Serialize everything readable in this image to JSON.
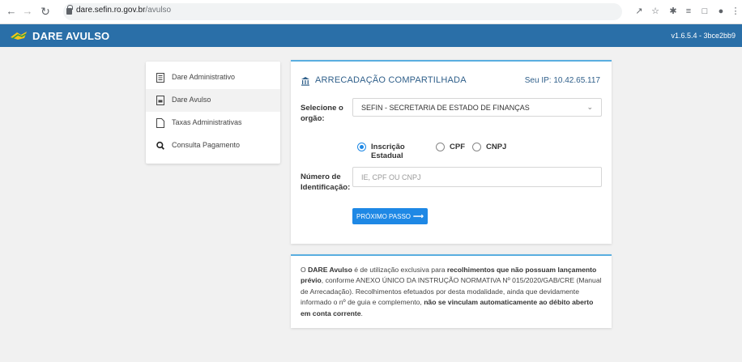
{
  "browser": {
    "url_domain": "dare.sefin.ro.gov.br",
    "url_path": "/avulso",
    "back_icon": "arrow-left-icon",
    "forward_icon": "arrow-right-icon",
    "reload_icon": "reload-icon"
  },
  "header": {
    "title": "DARE AVULSO",
    "version": "v1.6.5.4 - 3bce2bb9",
    "bg_color": "#2a6fa8"
  },
  "sidebar": {
    "items": [
      {
        "label": "Dare Administrativo",
        "icon": "document-list-icon"
      },
      {
        "label": "Dare Avulso",
        "icon": "document-icon",
        "active": true
      },
      {
        "label": "Taxas Administrativas",
        "icon": "file-icon"
      },
      {
        "label": "Consulta Pagamento",
        "icon": "search-icon"
      }
    ]
  },
  "form": {
    "title": "ARRECADAÇÃO COMPARTILHADA",
    "ip_label": "Seu IP: 10.42.65.117",
    "orgao_label_1": "Selecione o",
    "orgao_label_2": "orgão:",
    "orgao_selected": "SEFIN - SECRETARIA DE ESTADO DE FINANÇAS",
    "radios": [
      {
        "label": "Inscrição Estadual",
        "checked": true
      },
      {
        "label": "CPF",
        "checked": false
      },
      {
        "label": "CNPJ",
        "checked": false
      }
    ],
    "id_label_1": "Número de",
    "id_label_2": "Identificação:",
    "id_placeholder": "IE, CPF OU CNPJ",
    "next_button": "PRÓXIMO PASSO",
    "accent_color": "#1e88e5"
  },
  "info": {
    "t1": "O ",
    "b1": "DARE Avulso",
    "t2": " é de utilização exclusiva para ",
    "b2": "recolhimentos que não possuam lançamento prévio",
    "t3": ", conforme ANEXO ÚNICO DA INSTRUÇÃO NORMATIVA Nº 015/2020/GAB/CRE (Manual de Arrecadação). Recolhimentos efetuados por desta modalidade, ainda que devidamente informado o nº de guia e complemento, ",
    "b3": "não se vinculam automaticamente ao débito aberto em conta corrente",
    "t4": "."
  }
}
